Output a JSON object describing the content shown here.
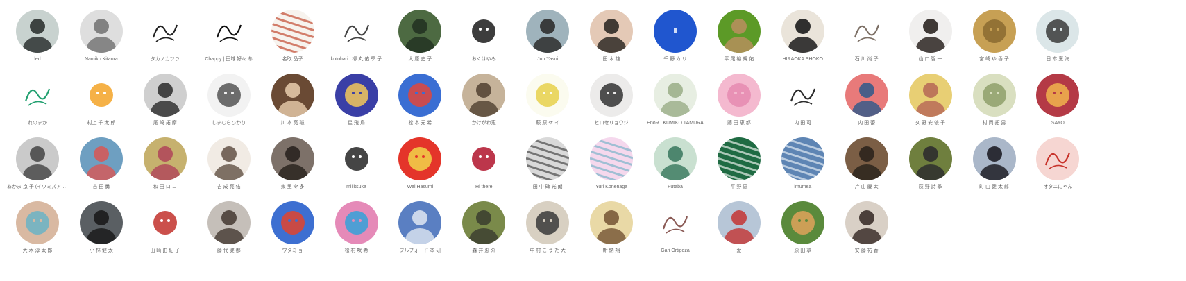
{
  "artists": [
    {
      "name": "led",
      "style": "photo",
      "colors": [
        "#c8d2cf",
        "#2d3331"
      ]
    },
    {
      "name": "Namiko Kitaura",
      "style": "photo",
      "colors": [
        "#dedede",
        "#777777"
      ]
    },
    {
      "name": "タカノカツラ",
      "style": "sketch",
      "colors": [
        "#ffffff",
        "#222222"
      ]
    },
    {
      "name": "Chappy | 田城 好々 冬",
      "style": "sketch",
      "colors": [
        "#ffffff",
        "#111111"
      ]
    },
    {
      "name": "名取 品子",
      "style": "pattern",
      "colors": [
        "#f7f3ee",
        "#c24b33"
      ]
    },
    {
      "name": "kotohari | 柳 丸 佑 季 子",
      "style": "sketch",
      "colors": [
        "#ffffff",
        "#444444"
      ]
    },
    {
      "name": "大 原 史 子",
      "style": "photo",
      "colors": [
        "#4d6a42",
        "#233322"
      ]
    },
    {
      "name": "おくはゆみ",
      "style": "illustration",
      "colors": [
        "#ffffff",
        "#1b1b1b"
      ]
    },
    {
      "name": "Jun Yasui",
      "style": "photo",
      "colors": [
        "#9fb3bc",
        "#2d2d2d"
      ]
    },
    {
      "name": "田 木 雄",
      "style": "photo",
      "colors": [
        "#e4c9b6",
        "#2f2a26"
      ]
    },
    {
      "name": "千 野 カ リ",
      "style": "solid",
      "colors": [
        "#2056cf",
        "#ffffff"
      ]
    },
    {
      "name": "平 尾 裕 規 佑",
      "style": "photo",
      "colors": [
        "#5c9a27",
        "#b58f5d"
      ]
    },
    {
      "name": "HIRAOKA SHOKO",
      "style": "photo",
      "colors": [
        "#eae4da",
        "#1b1b1b"
      ]
    },
    {
      "name": "石 川 尚 子",
      "style": "sketch",
      "colors": [
        "#ffffff",
        "#7d7066"
      ]
    },
    {
      "name": "山 口 智 一",
      "style": "photo",
      "colors": [
        "#f0efee",
        "#2b2521"
      ]
    },
    {
      "name": "宮 崎 ゆ 香 子",
      "style": "illustration",
      "colors": [
        "#c7a054",
        "#8a6a30"
      ]
    },
    {
      "name": "日 本 夏 海",
      "style": "illustration",
      "colors": [
        "#dbe6e8",
        "#3a3a3a"
      ]
    },
    {
      "name": "れのまか",
      "style": "sketch",
      "colors": [
        "#ffffff",
        "#22a070"
      ]
    },
    {
      "name": "村上 千 太 郎",
      "style": "illustration",
      "colors": [
        "#ffffff",
        "#f3a327"
      ]
    },
    {
      "name": "尾 崎 拓 摩",
      "style": "photo",
      "colors": [
        "#cfcfcf",
        "#333333"
      ]
    },
    {
      "name": "しまむらひかり",
      "style": "illustration",
      "colors": [
        "#f2f2f2",
        "#555555"
      ]
    },
    {
      "name": "川 本 亮 磁",
      "style": "photo",
      "colors": [
        "#6a4a34",
        "#e2c6a6"
      ]
    },
    {
      "name": "星 飛 鳥",
      "style": "illustration",
      "colors": [
        "#3a3fa6",
        "#f3c85b"
      ]
    },
    {
      "name": "松 本 元 希",
      "style": "illustration",
      "colors": [
        "#3a6ed3",
        "#e2463a"
      ]
    },
    {
      "name": "かけがわ恵",
      "style": "photo",
      "colors": [
        "#c6b39a",
        "#564636"
      ]
    },
    {
      "name": "萩 原 ケ イ",
      "style": "illustration",
      "colors": [
        "#fbfbef",
        "#e6d04b"
      ]
    },
    {
      "name": "ヒロセリョウジ",
      "style": "illustration",
      "colors": [
        "#ecebea",
        "#333333"
      ]
    },
    {
      "name": "EnoR | KUMIKO TAMURA",
      "style": "photo",
      "colors": [
        "#e7eee2",
        "#9db08c"
      ]
    },
    {
      "name": "藤 田 恵 都",
      "style": "illustration",
      "colors": [
        "#f4b9cf",
        "#e58ab0"
      ]
    },
    {
      "name": "内 田 可",
      "style": "sketch",
      "colors": [
        "#ffffff",
        "#2c2c2c"
      ]
    },
    {
      "name": "内 田 蕾",
      "style": "photo",
      "colors": [
        "#e87a7a",
        "#375b8a"
      ]
    },
    {
      "name": "久 野 安 依 子",
      "style": "photo",
      "colors": [
        "#e8cf74",
        "#b86b58"
      ]
    },
    {
      "name": "村 岡 拓 男",
      "style": "illustration",
      "colors": [
        "#d9dfc0",
        "#8ea06a"
      ]
    },
    {
      "name": "SAYO",
      "style": "illustration",
      "colors": [
        "#b43a46",
        "#f1b54e"
      ]
    },
    {
      "name": "あかま 京 子 (イワミズアサコ)",
      "style": "photo",
      "colors": [
        "#cacaca",
        "#4a4a4a"
      ]
    },
    {
      "name": "吉 田 勇",
      "style": "photo",
      "colors": [
        "#6e9fc1",
        "#d35a5a"
      ]
    },
    {
      "name": "和 田 ロ コ",
      "style": "photo",
      "colors": [
        "#c6b16e",
        "#b04a5a"
      ]
    },
    {
      "name": "吉 成 亮 佑",
      "style": "photo",
      "colors": [
        "#f1ebe4",
        "#6a5a4e"
      ]
    },
    {
      "name": "東 里 令 多",
      "style": "photo",
      "colors": [
        "#7d7169",
        "#2a2420"
      ]
    },
    {
      "name": "millitsuka",
      "style": "illustration",
      "colors": [
        "#ffffff",
        "#252525"
      ]
    },
    {
      "name": "Wei Hasumi",
      "style": "illustration",
      "colors": [
        "#e4352a",
        "#f2d34a"
      ]
    },
    {
      "name": "Hi there",
      "style": "illustration",
      "colors": [
        "#ffffff",
        "#b0132c"
      ]
    },
    {
      "name": "田 中 碑 光 朗",
      "style": "pattern",
      "colors": [
        "#d9d9d9",
        "#4a4a4a"
      ]
    },
    {
      "name": "Yuri Konenaga",
      "style": "pattern",
      "colors": [
        "#f5d8ed",
        "#7cb5c9"
      ]
    },
    {
      "name": "Futaba",
      "style": "photo",
      "colors": [
        "#c9e0d0",
        "#3f7c63"
      ]
    },
    {
      "name": "平 野 恵",
      "style": "pattern",
      "colors": [
        "#1f6b43",
        "#e8f0ea"
      ]
    },
    {
      "name": "imumea",
      "style": "pattern",
      "colors": [
        "#5e85b4",
        "#e2eaf2"
      ]
    },
    {
      "name": "片 山 慶 太",
      "style": "photo",
      "colors": [
        "#7b5e45",
        "#2c241c"
      ]
    },
    {
      "name": "荻 野 詩 季",
      "style": "photo",
      "colors": [
        "#6f7f3e",
        "#2e2e2e"
      ]
    },
    {
      "name": "町 山 健 太 郎",
      "style": "photo",
      "colors": [
        "#aab7c9",
        "#1e1e26"
      ]
    },
    {
      "name": "オタニにゃん",
      "style": "sketch",
      "colors": [
        "#f6d6d2",
        "#c8342c"
      ]
    },
    {
      "name": "大 木 淳 太 郎",
      "style": "illustration",
      "colors": [
        "#d9b9a2",
        "#6ab3c6"
      ]
    },
    {
      "name": "小 林 健 太",
      "style": "photo",
      "colors": [
        "#5a5f63",
        "#1b1b1b"
      ]
    },
    {
      "name": "山 崎 由 紀 子",
      "style": "illustration",
      "colors": [
        "#ffffff",
        "#c2312c"
      ]
    },
    {
      "name": "藤 代 健 都",
      "style": "photo",
      "colors": [
        "#c5bfb9",
        "#4a3f38"
      ]
    },
    {
      "name": "ワタミ ョ",
      "style": "illustration",
      "colors": [
        "#3d6fd1",
        "#e0442e"
      ]
    },
    {
      "name": "松 村 咲 希",
      "style": "illustration",
      "colors": [
        "#e58ab8",
        "#35a1d8"
      ]
    },
    {
      "name": "フルフォード 本 研",
      "style": "photo",
      "colors": [
        "#5a7fc2",
        "#d7e1ef"
      ]
    },
    {
      "name": "森 井 恵 介",
      "style": "photo",
      "colors": [
        "#7a8a4a",
        "#3d4030"
      ]
    },
    {
      "name": "中 村 こ う た 大",
      "style": "illustration",
      "colors": [
        "#d8d0c2",
        "#3a3a3a"
      ]
    },
    {
      "name": "新 納 翔",
      "style": "photo",
      "colors": [
        "#e9d9a6",
        "#7a5a3a"
      ]
    },
    {
      "name": "Gari Ortigoza",
      "style": "sketch",
      "colors": [
        "#ffffff",
        "#8a5a55"
      ]
    },
    {
      "name": "愛",
      "style": "photo",
      "colors": [
        "#b7c6d7",
        "#c33c3c"
      ]
    },
    {
      "name": "原 田 章",
      "style": "illustration",
      "colors": [
        "#5a8a3c",
        "#e0a25a"
      ]
    },
    {
      "name": "安 藤 祐 香",
      "style": "photo",
      "colors": [
        "#d9d0c6",
        "#3b2f2a"
      ]
    }
  ]
}
